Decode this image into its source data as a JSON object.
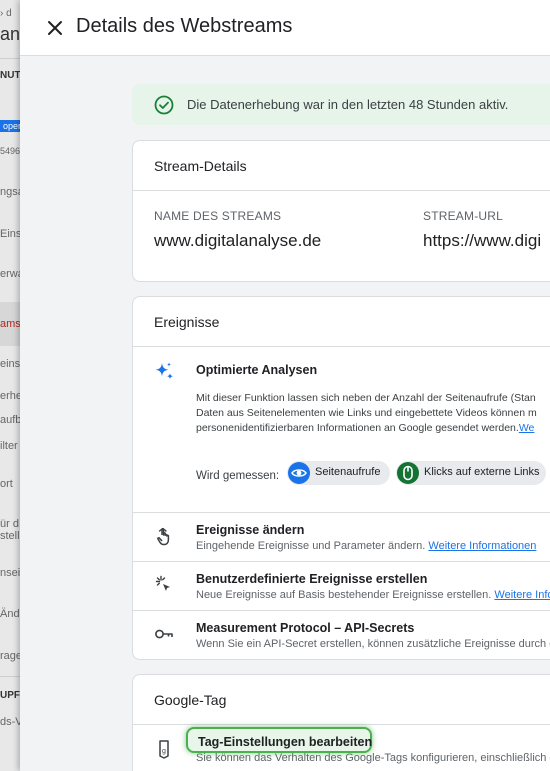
{
  "background": {
    "fragments": [
      "› d",
      "an",
      "NUT",
      "oper",
      "5496",
      "ngsa",
      "Eins",
      "erwa",
      "ams",
      "einst",
      "erhe",
      "aufb",
      "ilter",
      "ort",
      "ür d",
      "stell",
      "nsei",
      "Ände",
      "rage",
      "UPFU",
      "ds-V"
    ]
  },
  "panel": {
    "title": "Details des Webstreams"
  },
  "status": {
    "text": "Die Datenerhebung war in den letzten 48 Stunden aktiv.",
    "color": "#e6f4ea"
  },
  "stream_details": {
    "title": "Stream-Details",
    "name_label": "NAME DES STREAMS",
    "name_value": "www.digitalanalyse.de",
    "url_label": "STREAM-URL",
    "url_value": "https://www.digi"
  },
  "events": {
    "title": "Ereignisse",
    "optimized": {
      "title": "Optimierte Analysen",
      "lines": [
        "Mit dieser Funktion lassen sich neben der Anzahl der Seitenaufrufe (Stan",
        "Daten aus Seitenelementen wie Links und eingebettete Videos können m",
        "personenidentifizierbaren Informationen an Google gesendet werden."
      ],
      "link": "We",
      "measured_label": "Wird gemessen:",
      "chips": [
        "Seitenaufrufe",
        "Klicks auf externe Links"
      ]
    },
    "rows": [
      {
        "icon": "touch-click-icon",
        "title": "Ereignisse ändern",
        "desc": "Eingehende Ereignisse und Parameter ändern.",
        "link": "Weitere Informationen"
      },
      {
        "icon": "sparkle-cursor-icon",
        "title": "Benutzerdefinierte Ereignisse erstellen",
        "desc": "Neue Ereignisse auf Basis bestehender Ereignisse erstellen.",
        "link": "Weitere Info"
      },
      {
        "icon": "key-icon",
        "title": "Measurement Protocol – API-Secrets",
        "desc": "Wenn Sie ein API-Secret erstellen, können zusätzliche Ereignisse durch d"
      }
    ]
  },
  "google_tag": {
    "title": "Google-Tag",
    "row": {
      "icon": "tag-icon",
      "title": "Tag-Einstellungen bearbeiten",
      "desc": "Sie können das Verhalten des Google-Tags konfigurieren, einschließlich d"
    }
  },
  "colors": {
    "accent": "#1a73e8",
    "highlight": "#4caf50"
  }
}
